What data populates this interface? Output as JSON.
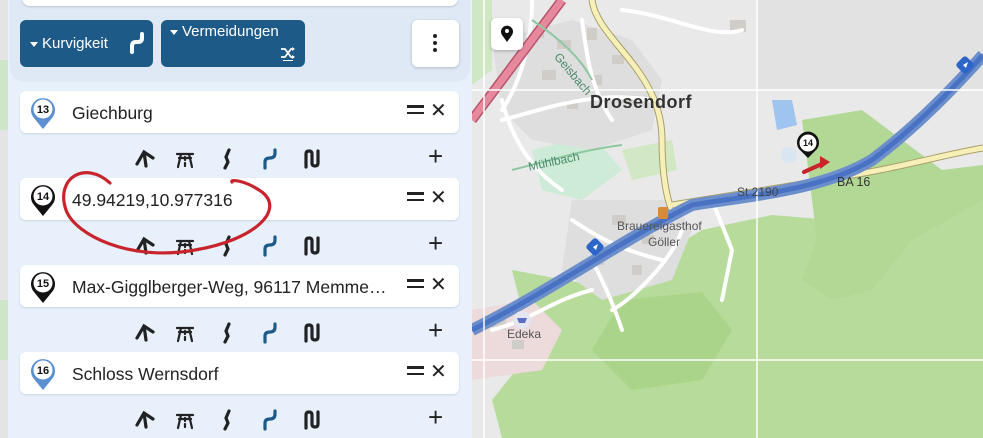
{
  "toolbar": {
    "curvature_label": "Kurvigkeit",
    "avoidances_label": "Vermeidungen"
  },
  "waypoints": [
    {
      "number": "13",
      "name": "Giechburg",
      "pin_style": "outline"
    },
    {
      "number": "14",
      "name": "49.94219,10.977316",
      "pin_style": "filled"
    },
    {
      "number": "15",
      "name": "Max-Gigglberger-Weg, 96117 Memmelsdorf",
      "pin_style": "filled"
    },
    {
      "number": "16",
      "name": "Schloss Wernsdorf",
      "pin_style": "outline"
    }
  ],
  "colors": {
    "accent": "#1e5a87",
    "route": "#4a72c4",
    "annotation": "#c8242c",
    "forest": "#a9d489"
  },
  "map": {
    "labels": {
      "town": "Drosendorf",
      "stream_1": "Geisbach",
      "stream_2": "Mühlbach",
      "road_1": "St 2190",
      "road_2": "BA 16",
      "poi_1_line1": "Brauereigasthof",
      "poi_1_line2": "Göller",
      "poi_2": "Edeka"
    },
    "marker_number": "14"
  }
}
